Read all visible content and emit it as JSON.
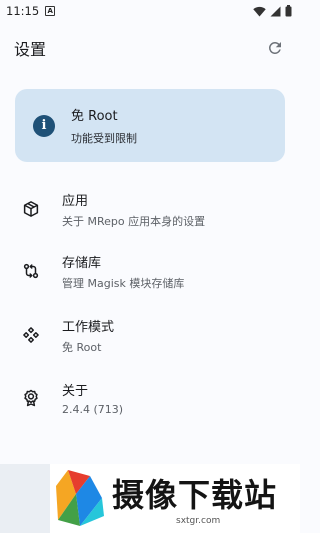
{
  "status_bar": {
    "time": "11:15",
    "notification_icon": "a-icon",
    "wifi_icon": "wifi-icon",
    "signal_icon": "signal-icon",
    "battery_icon": "battery-icon"
  },
  "app_bar": {
    "title": "设置",
    "refresh_icon": "refresh-icon"
  },
  "root_card": {
    "title": "免 Root",
    "subtitle": "功能受到限制",
    "icon": "info-icon",
    "icon_color": "#1f5177",
    "background": "#d3e4f3"
  },
  "menu": {
    "items": [
      {
        "title": "应用",
        "subtitle": "关于 MRepo 应用本身的设置",
        "icon": "cube-icon"
      },
      {
        "title": "存储库",
        "subtitle": "管理 Magisk 模块存储库",
        "icon": "git-compare-icon"
      },
      {
        "title": "工作模式",
        "subtitle": "免 Root",
        "icon": "diamond-grid-icon"
      },
      {
        "title": "关于",
        "subtitle": "2.4.4 (713)",
        "icon": "award-icon"
      }
    ]
  },
  "watermark": {
    "title": "摄像下载站",
    "url": "sxtgr.com"
  }
}
